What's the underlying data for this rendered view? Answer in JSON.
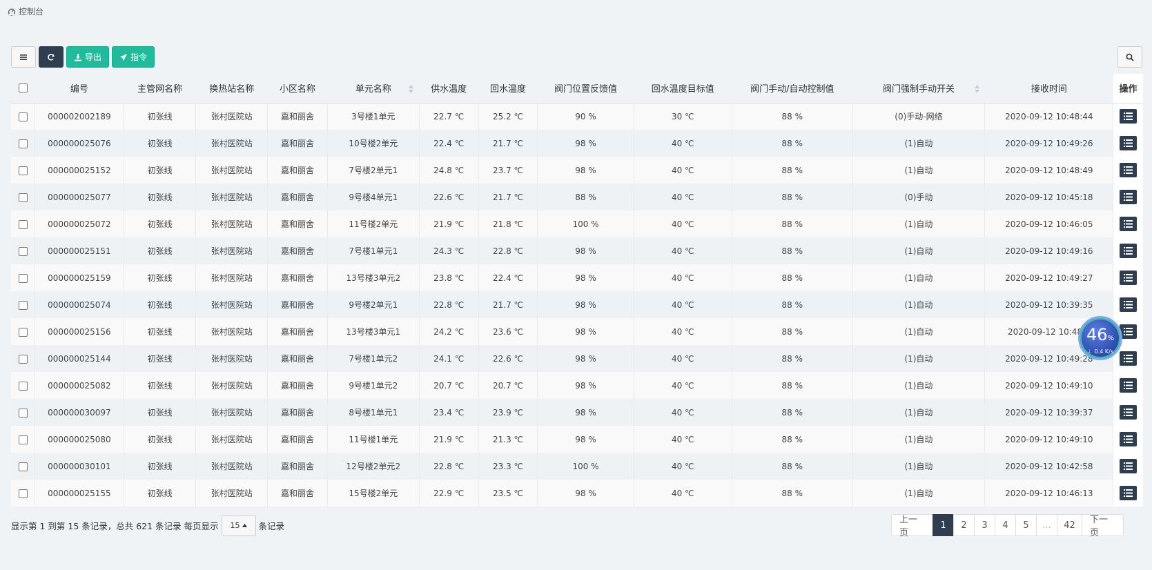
{
  "breadcrumb": {
    "icon": "dashboard-icon",
    "label": "控制台"
  },
  "toolbar": {
    "export_label": "导出",
    "command_label": "指令"
  },
  "table": {
    "headers": {
      "code": "编号",
      "main_net": "主管网名称",
      "station": "换热站名称",
      "community": "小区名称",
      "unit": "单元名称",
      "supply_temp": "供水温度",
      "return_temp": "回水温度",
      "valve_feedback": "阀门位置反馈值",
      "return_target": "回水温度目标值",
      "valve_control": "阀门手动/自动控制值",
      "force_switch": "阀门强制手动开关",
      "recv_time": "接收时间",
      "op": "操作"
    },
    "rows": [
      {
        "code": "000002002189",
        "main_net": "初张线",
        "station": "张村医院站",
        "community": "嘉和丽舍",
        "unit": "3号楼1单元",
        "supply_temp": "22.7 ℃",
        "return_temp": "25.2 ℃",
        "valve_feedback": "90 %",
        "return_target": "30 ℃",
        "valve_control": "88 %",
        "force_switch": "(0)手动-网络",
        "recv_time": "2020-09-12 10:48:44"
      },
      {
        "code": "000000025076",
        "main_net": "初张线",
        "station": "张村医院站",
        "community": "嘉和丽舍",
        "unit": "10号楼2单元",
        "supply_temp": "22.4 ℃",
        "return_temp": "21.7 ℃",
        "valve_feedback": "98 %",
        "return_target": "40 ℃",
        "valve_control": "88 %",
        "force_switch": "(1)自动",
        "recv_time": "2020-09-12 10:49:26"
      },
      {
        "code": "000000025152",
        "main_net": "初张线",
        "station": "张村医院站",
        "community": "嘉和丽舍",
        "unit": "7号楼2单元1",
        "supply_temp": "24.8 ℃",
        "return_temp": "23.7 ℃",
        "valve_feedback": "98 %",
        "return_target": "40 ℃",
        "valve_control": "88 %",
        "force_switch": "(1)自动",
        "recv_time": "2020-09-12 10:48:49"
      },
      {
        "code": "000000025077",
        "main_net": "初张线",
        "station": "张村医院站",
        "community": "嘉和丽舍",
        "unit": "9号楼4单元1",
        "supply_temp": "22.6 ℃",
        "return_temp": "21.7 ℃",
        "valve_feedback": "88 %",
        "return_target": "40 ℃",
        "valve_control": "88 %",
        "force_switch": "(0)手动",
        "recv_time": "2020-09-12 10:45:18"
      },
      {
        "code": "000000025072",
        "main_net": "初张线",
        "station": "张村医院站",
        "community": "嘉和丽舍",
        "unit": "11号楼2单元",
        "supply_temp": "21.9 ℃",
        "return_temp": "21.8 ℃",
        "valve_feedback": "100 %",
        "return_target": "40 ℃",
        "valve_control": "88 %",
        "force_switch": "(1)自动",
        "recv_time": "2020-09-12 10:46:05"
      },
      {
        "code": "000000025151",
        "main_net": "初张线",
        "station": "张村医院站",
        "community": "嘉和丽舍",
        "unit": "7号楼1单元1",
        "supply_temp": "24.3 ℃",
        "return_temp": "22.8 ℃",
        "valve_feedback": "98 %",
        "return_target": "40 ℃",
        "valve_control": "88 %",
        "force_switch": "(1)自动",
        "recv_time": "2020-09-12 10:49:16"
      },
      {
        "code": "000000025159",
        "main_net": "初张线",
        "station": "张村医院站",
        "community": "嘉和丽舍",
        "unit": "13号楼3单元2",
        "supply_temp": "23.8 ℃",
        "return_temp": "22.4 ℃",
        "valve_feedback": "98 %",
        "return_target": "40 ℃",
        "valve_control": "88 %",
        "force_switch": "(1)自动",
        "recv_time": "2020-09-12 10:49:27"
      },
      {
        "code": "000000025074",
        "main_net": "初张线",
        "station": "张村医院站",
        "community": "嘉和丽舍",
        "unit": "9号楼2单元1",
        "supply_temp": "22.8 ℃",
        "return_temp": "21.7 ℃",
        "valve_feedback": "98 %",
        "return_target": "40 ℃",
        "valve_control": "88 %",
        "force_switch": "(1)自动",
        "recv_time": "2020-09-12 10:39:35"
      },
      {
        "code": "000000025156",
        "main_net": "初张线",
        "station": "张村医院站",
        "community": "嘉和丽舍",
        "unit": "13号楼3单元1",
        "supply_temp": "24.2 ℃",
        "return_temp": "23.6 ℃",
        "valve_feedback": "98 %",
        "return_target": "40 ℃",
        "valve_control": "88 %",
        "force_switch": "(1)自动",
        "recv_time": "2020-09-12 10:48:3"
      },
      {
        "code": "000000025144",
        "main_net": "初张线",
        "station": "张村医院站",
        "community": "嘉和丽舍",
        "unit": "7号楼1单元2",
        "supply_temp": "24.1 ℃",
        "return_temp": "22.6 ℃",
        "valve_feedback": "98 %",
        "return_target": "40 ℃",
        "valve_control": "88 %",
        "force_switch": "(1)自动",
        "recv_time": "2020-09-12 10:49:28"
      },
      {
        "code": "000000025082",
        "main_net": "初张线",
        "station": "张村医院站",
        "community": "嘉和丽舍",
        "unit": "9号楼1单元2",
        "supply_temp": "20.7 ℃",
        "return_temp": "20.7 ℃",
        "valve_feedback": "98 %",
        "return_target": "40 ℃",
        "valve_control": "88 %",
        "force_switch": "(1)自动",
        "recv_time": "2020-09-12 10:49:10"
      },
      {
        "code": "000000030097",
        "main_net": "初张线",
        "station": "张村医院站",
        "community": "嘉和丽舍",
        "unit": "8号楼1单元1",
        "supply_temp": "23.4 ℃",
        "return_temp": "23.9 ℃",
        "valve_feedback": "98 %",
        "return_target": "40 ℃",
        "valve_control": "88 %",
        "force_switch": "(1)自动",
        "recv_time": "2020-09-12 10:39:37"
      },
      {
        "code": "000000025080",
        "main_net": "初张线",
        "station": "张村医院站",
        "community": "嘉和丽舍",
        "unit": "11号楼1单元",
        "supply_temp": "21.9 ℃",
        "return_temp": "21.3 ℃",
        "valve_feedback": "98 %",
        "return_target": "40 ℃",
        "valve_control": "88 %",
        "force_switch": "(1)自动",
        "recv_time": "2020-09-12 10:49:10"
      },
      {
        "code": "000000030101",
        "main_net": "初张线",
        "station": "张村医院站",
        "community": "嘉和丽舍",
        "unit": "12号楼2单元2",
        "supply_temp": "22.8 ℃",
        "return_temp": "23.3 ℃",
        "valve_feedback": "100 %",
        "return_target": "40 ℃",
        "valve_control": "88 %",
        "force_switch": "(1)自动",
        "recv_time": "2020-09-12 10:42:58"
      },
      {
        "code": "000000025155",
        "main_net": "初张线",
        "station": "张村医院站",
        "community": "嘉和丽舍",
        "unit": "15号楼2单元",
        "supply_temp": "22.9 ℃",
        "return_temp": "23.5 ℃",
        "valve_feedback": "98 %",
        "return_target": "40 ℃",
        "valve_control": "88 %",
        "force_switch": "(1)自动",
        "recv_time": "2020-09-12 10:46:13"
      }
    ]
  },
  "footer": {
    "info_prefix": "显示第 1 到第 15 条记录，总共 621 条记录 每页显示",
    "page_size": "15",
    "info_suffix": "条记录"
  },
  "pagination": {
    "prev": "上一页",
    "next": "下一页",
    "pages": [
      "1",
      "2",
      "3",
      "4",
      "5",
      "...",
      "42"
    ],
    "current": "1"
  },
  "speed_widget": {
    "percent": "46",
    "percent_unit": "%",
    "rate": "0.4 K/s"
  },
  "colors": {
    "dark": "#2e3e4e",
    "green": "#1fbb9c",
    "background": "#f0f3f6"
  }
}
